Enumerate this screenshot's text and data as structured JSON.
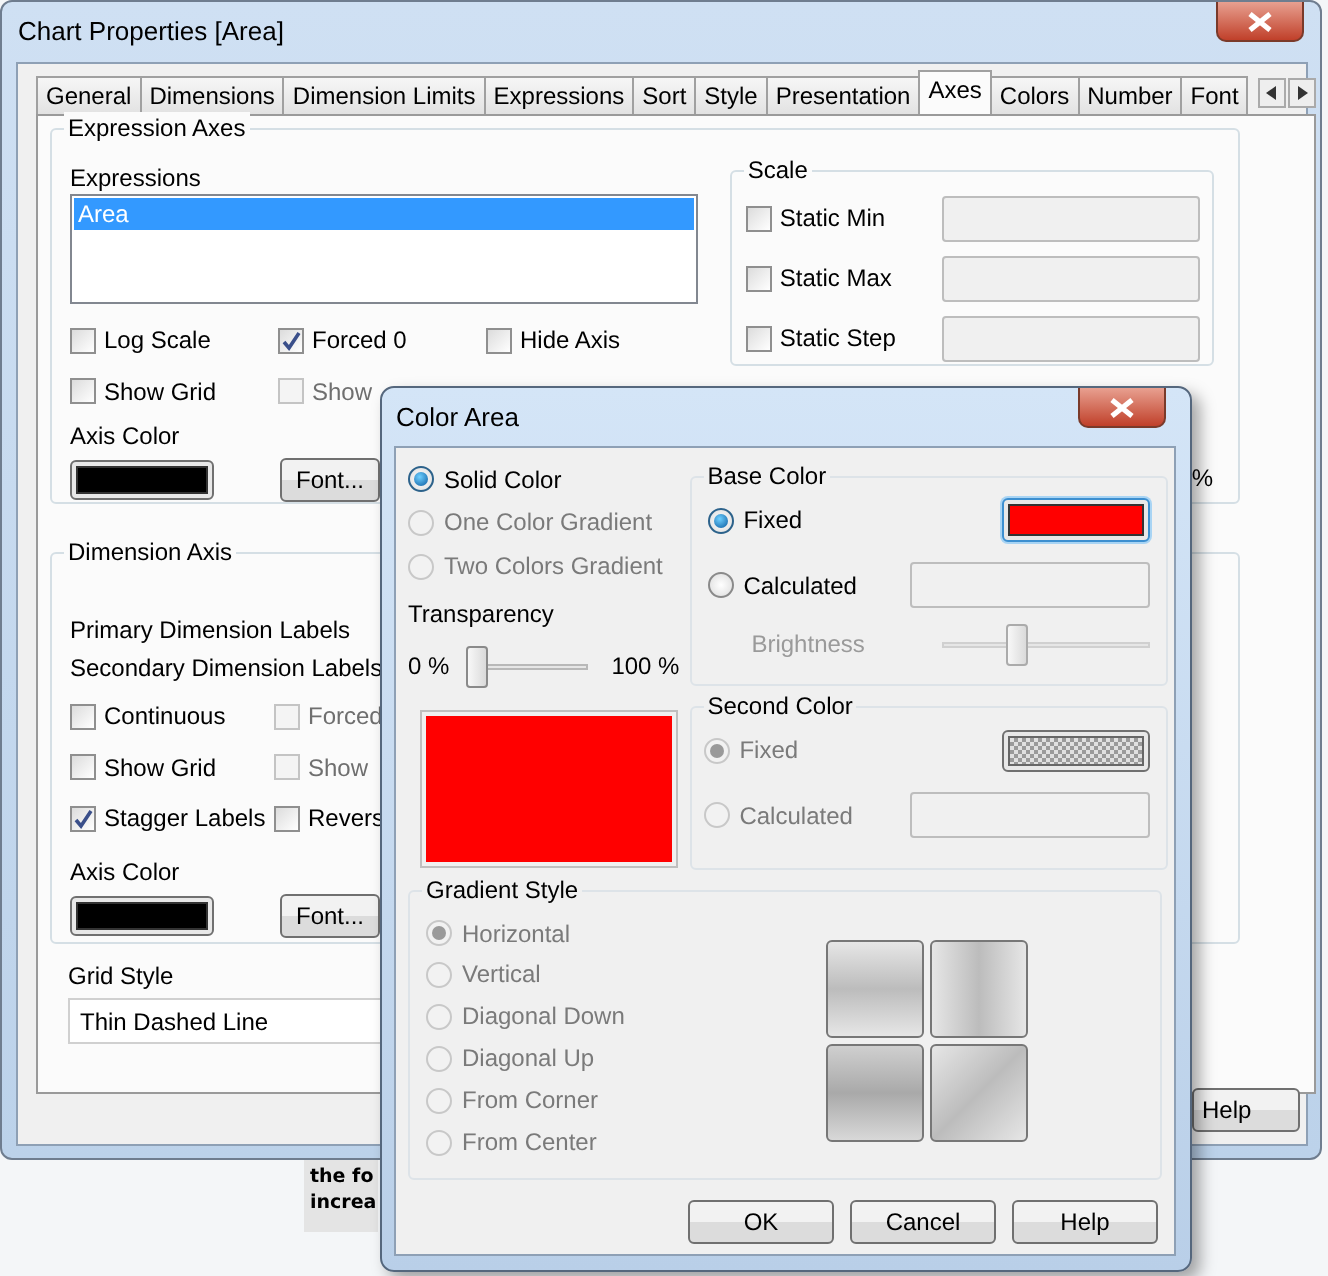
{
  "main_window": {
    "title": "Chart Properties [Area]",
    "tabs": [
      {
        "label": "General",
        "selected": false
      },
      {
        "label": "Dimensions",
        "selected": false
      },
      {
        "label": "Dimension Limits",
        "selected": false
      },
      {
        "label": "Expressions",
        "selected": false
      },
      {
        "label": "Sort",
        "selected": false
      },
      {
        "label": "Style",
        "selected": false
      },
      {
        "label": "Presentation",
        "selected": false
      },
      {
        "label": "Axes",
        "selected": true
      },
      {
        "label": "Colors",
        "selected": false
      },
      {
        "label": "Number",
        "selected": false
      },
      {
        "label": "Font",
        "selected": false
      }
    ],
    "expression_axes": {
      "title": "Expression Axes",
      "expressions_label": "Expressions",
      "expressions": [
        {
          "label": "Area",
          "selected": true
        }
      ],
      "options": [
        {
          "label": "Log Scale",
          "checked": false,
          "disabled": false
        },
        {
          "label": "Forced 0",
          "checked": true,
          "disabled": false
        },
        {
          "label": "Hide Axis",
          "checked": false,
          "disabled": false
        },
        {
          "label": "Show Grid",
          "checked": false,
          "disabled": false
        },
        {
          "label": "Show",
          "checked": false,
          "disabled": true
        }
      ],
      "axis_color_label": "Axis Color",
      "font_button": "Font..."
    },
    "scale": {
      "title": "Scale",
      "rows": [
        {
          "label": "Static Min",
          "checked": false
        },
        {
          "label": "Static Max",
          "checked": false
        },
        {
          "label": "Static Step",
          "checked": false
        }
      ]
    },
    "percent_mark": "%",
    "dimension_axis": {
      "title": "Dimension Axis",
      "labels": [
        "Primary Dimension Labels",
        "Secondary Dimension Labels"
      ],
      "options": [
        {
          "label": "Continuous",
          "checked": false,
          "disabled": false
        },
        {
          "label": "Forced",
          "checked": false,
          "disabled": true
        },
        {
          "label": "Show Grid",
          "checked": false,
          "disabled": false
        },
        {
          "label": "Show",
          "checked": false,
          "disabled": true
        },
        {
          "label": "Stagger Labels",
          "checked": true,
          "disabled": false
        },
        {
          "label": "Revers",
          "checked": false,
          "disabled": false
        }
      ],
      "axis_color_label": "Axis Color",
      "font_button": "Font..."
    },
    "grid_style": {
      "label": "Grid Style",
      "value": "Thin Dashed Line"
    },
    "help_button": "Help"
  },
  "background_text": [
    "the fo",
    "increa"
  ],
  "color_dialog": {
    "title": "Color Area",
    "fill_modes": [
      {
        "label": "Solid Color",
        "selected": true,
        "disabled": false
      },
      {
        "label": "One Color Gradient",
        "selected": false,
        "disabled": true
      },
      {
        "label": "Two Colors Gradient",
        "selected": false,
        "disabled": true
      }
    ],
    "transparency": {
      "label": "Transparency",
      "min_label": "0 %",
      "max_label": "100 %",
      "level": 0
    },
    "base_color": {
      "title": "Base Color",
      "options": [
        {
          "label": "Fixed",
          "selected": true,
          "disabled": false
        },
        {
          "label": "Calculated",
          "selected": false,
          "disabled": false
        }
      ],
      "color": "#ff0000",
      "brightness": {
        "label": "Brightness",
        "level": 0.35,
        "disabled": true
      }
    },
    "second_color": {
      "title": "Second Color",
      "options": [
        {
          "label": "Fixed",
          "selected": true,
          "disabled": true
        },
        {
          "label": "Calculated",
          "selected": false,
          "disabled": true
        }
      ]
    },
    "gradient_style": {
      "title": "Gradient Style",
      "options": [
        {
          "label": "Horizontal",
          "selected": true,
          "disabled": true
        },
        {
          "label": "Vertical",
          "selected": false,
          "disabled": true
        },
        {
          "label": "Diagonal Down",
          "selected": false,
          "disabled": true
        },
        {
          "label": "Diagonal Up",
          "selected": false,
          "disabled": true
        },
        {
          "label": "From Corner",
          "selected": false,
          "disabled": true
        },
        {
          "label": "From Center",
          "selected": false,
          "disabled": true
        }
      ]
    },
    "buttons": [
      "OK",
      "Cancel",
      "Help"
    ]
  }
}
